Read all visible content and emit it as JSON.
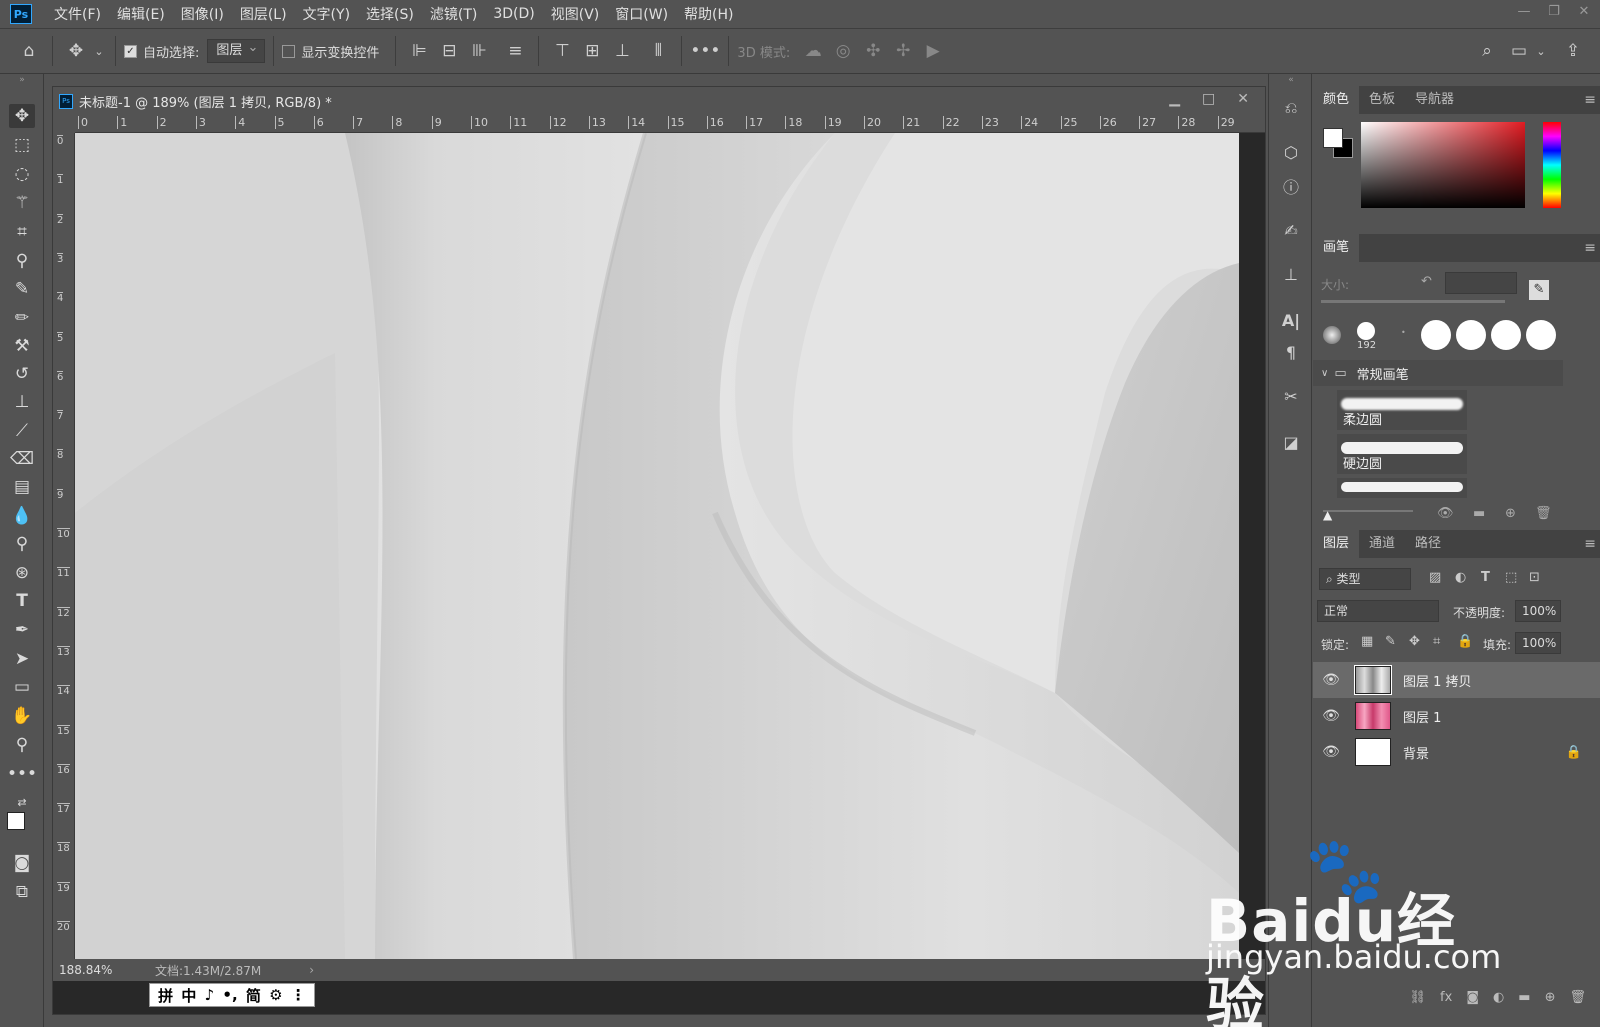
{
  "app": {
    "logo": "Ps"
  },
  "menu": [
    "文件(F)",
    "编辑(E)",
    "图像(I)",
    "图层(L)",
    "文字(Y)",
    "选择(S)",
    "滤镜(T)",
    "3D(D)",
    "视图(V)",
    "窗口(W)",
    "帮助(H)"
  ],
  "window_controls": {
    "minimize": "—",
    "restore": "❐",
    "close": "✕"
  },
  "options": {
    "auto_select_label": "自动选择:",
    "auto_select_checked": true,
    "auto_select_target": "图层",
    "show_transform_label": "显示变换控件",
    "show_transform_checked": false,
    "mode_3d_label": "3D 模式:",
    "more_icon": "•••"
  },
  "document": {
    "title": "未标题-1 @ 189% (图层 1 拷贝, RGB/8) *",
    "doc_icon": "Ps",
    "zoom": "188.84%",
    "doc_size": "文档:1.43M/2.87M",
    "ruler_h": [
      "0",
      "1",
      "2",
      "3",
      "4",
      "5",
      "6",
      "7",
      "8",
      "9",
      "10",
      "11",
      "12",
      "13",
      "14",
      "15",
      "16",
      "17",
      "18",
      "19",
      "20",
      "21",
      "22",
      "23",
      "24",
      "25",
      "26",
      "27",
      "28",
      "29"
    ],
    "ruler_v": [
      "0",
      "1",
      "2",
      "3",
      "4",
      "5",
      "6",
      "7",
      "8",
      "9",
      "10",
      "11",
      "12",
      "13",
      "14",
      "15",
      "16",
      "17",
      "18",
      "19",
      "20"
    ]
  },
  "ime": {
    "items": [
      "拼",
      "中",
      "♪",
      "•,",
      "简",
      "⚙",
      "⋮"
    ]
  },
  "color_panel": {
    "tabs": [
      "颜色",
      "色板",
      "导航器"
    ],
    "fg_color": "#ffffff",
    "bg_color": "#000000",
    "hue_color": "#e11b22"
  },
  "brush_panel": {
    "tab": "画笔",
    "size_label": "大小:",
    "preset_size": "192",
    "group_name": "常规画笔",
    "strokes": [
      "柔边圆",
      "硬边圆",
      ""
    ]
  },
  "layers_panel": {
    "tabs": [
      "图层",
      "通道",
      "路径"
    ],
    "filter_label": "类型",
    "blend_mode": "正常",
    "opacity_label": "不透明度:",
    "opacity_value": "100%",
    "lock_label": "锁定:",
    "fill_label": "填充:",
    "fill_value": "100%",
    "layers": [
      {
        "name": "图层 1 拷贝",
        "selected": true,
        "thumb": "gray"
      },
      {
        "name": "图层 1",
        "selected": false,
        "thumb": "pink"
      },
      {
        "name": "背景",
        "selected": false,
        "thumb": "white",
        "locked": true
      }
    ]
  },
  "watermark": {
    "brand": "Bai",
    "brand_du": "du",
    "brand_cn": "经验",
    "url": "jingyan.baidu.com"
  }
}
